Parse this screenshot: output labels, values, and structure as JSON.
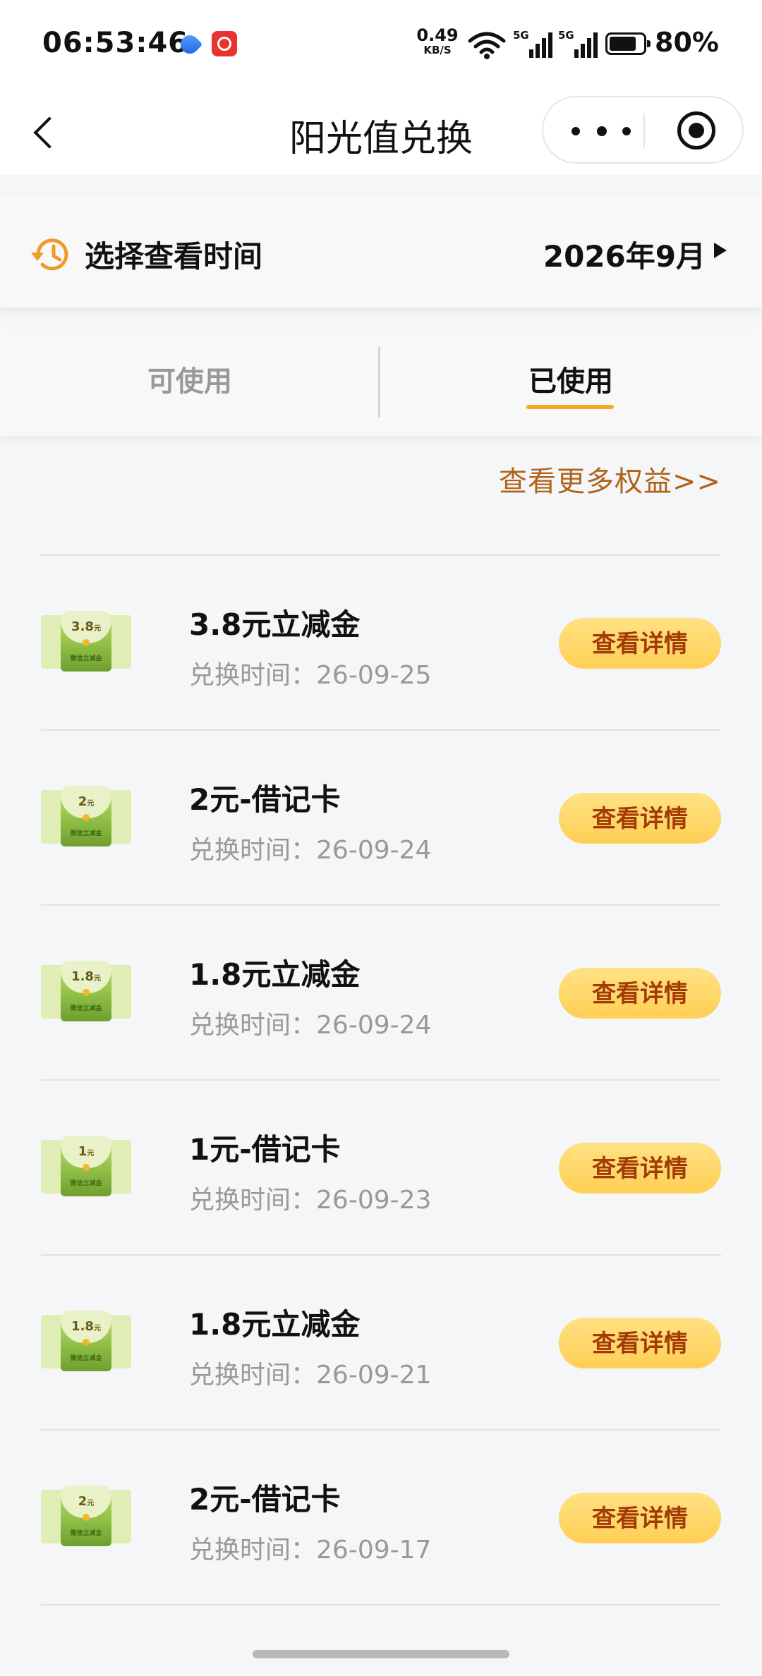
{
  "status_bar": {
    "time": "06:53:46",
    "net_speed_value": "0.49",
    "net_speed_unit": "KB/S",
    "signal_label_1": "5G",
    "signal_label_2": "5G",
    "battery_level": 0.8,
    "battery_text": "80%"
  },
  "nav": {
    "title": "阳光值兑换",
    "back_icon": "chevron-left-icon",
    "more_icon": "more-dots-icon",
    "close_icon": "target-icon"
  },
  "time_selector": {
    "icon": "history-clock-icon",
    "label": "选择查看时间",
    "value": "2026年9月",
    "arrow_icon": "triangle-right-icon"
  },
  "tabs": [
    {
      "label": "可使用",
      "active": false
    },
    {
      "label": "已使用",
      "active": true
    }
  ],
  "more_link": "查看更多权益>>",
  "accent_color": "#f7a823",
  "date_prefix": "兑换时间：",
  "button_label": "查看详情",
  "records": [
    {
      "title": "3.8元立减金",
      "date": "26-09-25",
      "thumb_value": "3.8",
      "thumb_unit": "元",
      "thumb_tag": "微信立减金"
    },
    {
      "title": "2元-借记卡",
      "date": "26-09-24",
      "thumb_value": "2",
      "thumb_unit": "元",
      "thumb_tag": "微信立减金"
    },
    {
      "title": "1.8元立减金",
      "date": "26-09-24",
      "thumb_value": "1.8",
      "thumb_unit": "元",
      "thumb_tag": "微信立减金"
    },
    {
      "title": "1元-借记卡",
      "date": "26-09-23",
      "thumb_value": "1",
      "thumb_unit": "元",
      "thumb_tag": "微信立减金"
    },
    {
      "title": "1.8元立减金",
      "date": "26-09-21",
      "thumb_value": "1.8",
      "thumb_unit": "元",
      "thumb_tag": "微信立减金"
    },
    {
      "title": "2元-借记卡",
      "date": "26-09-17",
      "thumb_value": "2",
      "thumb_unit": "元",
      "thumb_tag": "微信立减金"
    }
  ]
}
